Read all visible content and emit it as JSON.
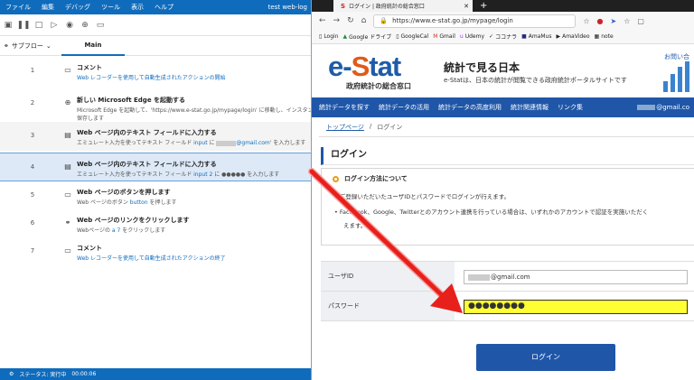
{
  "pad": {
    "menu": [
      "ファイル",
      "編集",
      "デバッグ",
      "ツール",
      "表示",
      "ヘルプ"
    ],
    "window_title": "test web-log",
    "subflow_label": "サブフロー",
    "main_tab": "Main",
    "steps": [
      {
        "num": "1",
        "icon": "comment-icon",
        "title": "コメント",
        "desc": "Web レコーダーを使用して自動生成されたアクションの開始"
      },
      {
        "num": "2",
        "icon": "globe-icon",
        "title": "新しい Microsoft Edge を起動する",
        "desc": "Microsoft Edge を起動して、'https://www.e-stat.go.jp/mypage/login' に移動し、インスタンスを",
        "desc2": "保存します"
      },
      {
        "num": "3",
        "icon": "textfield-icon",
        "title": "Web ページ内のテキスト フィールドに入力する",
        "desc_pre": "エミュレート入力を使ってテキスト フィールド",
        "desc_link": "input",
        "desc_mid": " に ",
        "desc_val": "@gmail.com",
        "desc_post": "' を入力します"
      },
      {
        "num": "4",
        "icon": "textfield-icon",
        "title": "Web ページ内のテキスト フィールドに入力する",
        "desc_pre": "エミュレート入力を使ってテキスト フィールド",
        "desc_link": "input 2",
        "desc_mid": " に ",
        "desc_val": "●●●●●",
        "desc_post": " を入力します"
      },
      {
        "num": "5",
        "icon": "button-icon",
        "title": "Web ページのボタンを押します",
        "desc_pre": "Web ページのボタン",
        "desc_link": "button",
        "desc_post": " を押します"
      },
      {
        "num": "6",
        "icon": "link-icon",
        "title": "Web ページのリンクをクリックします",
        "desc_pre": "Webページの",
        "desc_link": "a 7",
        "desc_post": " をクリックします"
      },
      {
        "num": "7",
        "icon": "comment-icon",
        "title": "コメント",
        "desc": "Web レコーダーを使用して自動生成されたアクションの終了"
      }
    ],
    "status": "ステータス: 実行中",
    "elapsed": "00:00:06"
  },
  "browser": {
    "tab_title": "ログイン | 政府統計の総合窓口",
    "url": "https://www.e-stat.go.jp/mypage/login",
    "bookmarks": [
      "Login",
      "Google ドライブ",
      "GoogleCal",
      "Gmail",
      "Udemy",
      "ココナラ",
      "AmaMus",
      "AmaVideo",
      "note"
    ]
  },
  "site": {
    "logo_main_pre": "e-",
    "logo_main_s": "S",
    "logo_main_post": "tat",
    "logo_sub": "政府統計の総合窓口",
    "title": "統計で見る日本",
    "subtitle": "e-Statは、日本の統計が閲覧できる政府統計ポータルサイトです",
    "help": "お問い合",
    "nav": [
      "統計データを探す",
      "統計データの活用",
      "統計データの高度利用",
      "統計関連情報",
      "リンク集"
    ],
    "nav_user": "@gmail.co",
    "breadcrumb_top": "トップページ",
    "breadcrumb_sep": "/",
    "breadcrumb_current": "ログイン",
    "login_heading": "ログイン",
    "info_title": "ログイン方法について",
    "info_b1": "ご登録いただいたユーザIDとパスワードでログインが行えます。",
    "info_b2": "Facebook、Google、Twitterとのアカウント連携を行っている場合は、いずれかのアカウントで認証を実施いただく",
    "info_b2b": "えます。",
    "userid_label": "ユーザID",
    "userid_value": "@gmail.com",
    "password_label": "パスワード",
    "password_value": "●●●●●●●●",
    "login_button": "ログイン"
  },
  "colors": {
    "pad_blue": "#0f6cbd",
    "estat_blue": "#1f56a8",
    "highlight_yellow": "#ffff33",
    "arrow_red": "#e8201c"
  }
}
